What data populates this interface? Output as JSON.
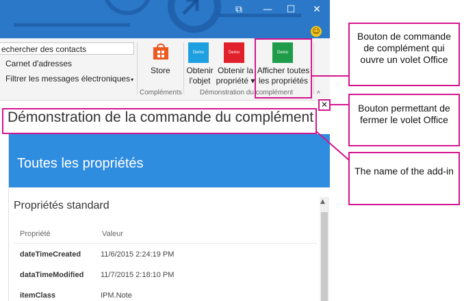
{
  "window": {
    "titlebar_color": "#2b78c8",
    "controls": {
      "restore": "⧉",
      "minimize": "—",
      "maximize": "☐",
      "close": "✕"
    },
    "feedback_icon": "☺"
  },
  "ribbon": {
    "search_contacts": "echercher des contacts",
    "address_book": "Carnet d'adresses",
    "filter_email": "Filtrer les messages électroniques",
    "filter_caret": "▾",
    "store_label": "Store",
    "group_addins": "Compléments",
    "tile_demo": "Demo",
    "get_object": [
      "Obtenir",
      "l'objet"
    ],
    "get_property": [
      "Obtenir la",
      "propriété ▾"
    ],
    "show_all": [
      "Afficher toutes",
      "les propriétés"
    ],
    "group_demo": "Démonstration du complément",
    "collapse": "^"
  },
  "pane": {
    "close": "✕",
    "title": "Démonstration de la commande du complément",
    "header": "Toutes les propriétés",
    "section": "Propriétés standard",
    "col_property": "Propriété",
    "col_value": "Valeur",
    "rows": [
      {
        "key": "dateTimeCreated",
        "value": "11/6/2015 2:24:19 PM"
      },
      {
        "key": "dataTimeModified",
        "value": "11/7/2015 2:18:10 PM"
      },
      {
        "key": "itemClass",
        "value": "IPM.Note"
      }
    ],
    "accent_color": "#2f8de0"
  },
  "callouts": {
    "command_button": "Bouton de commande de complément qui ouvre un volet Office",
    "close_button": "Bouton permettant de fermer le volet Office",
    "addin_name": "The name of the add-in",
    "highlight_color": "#d4148d"
  }
}
